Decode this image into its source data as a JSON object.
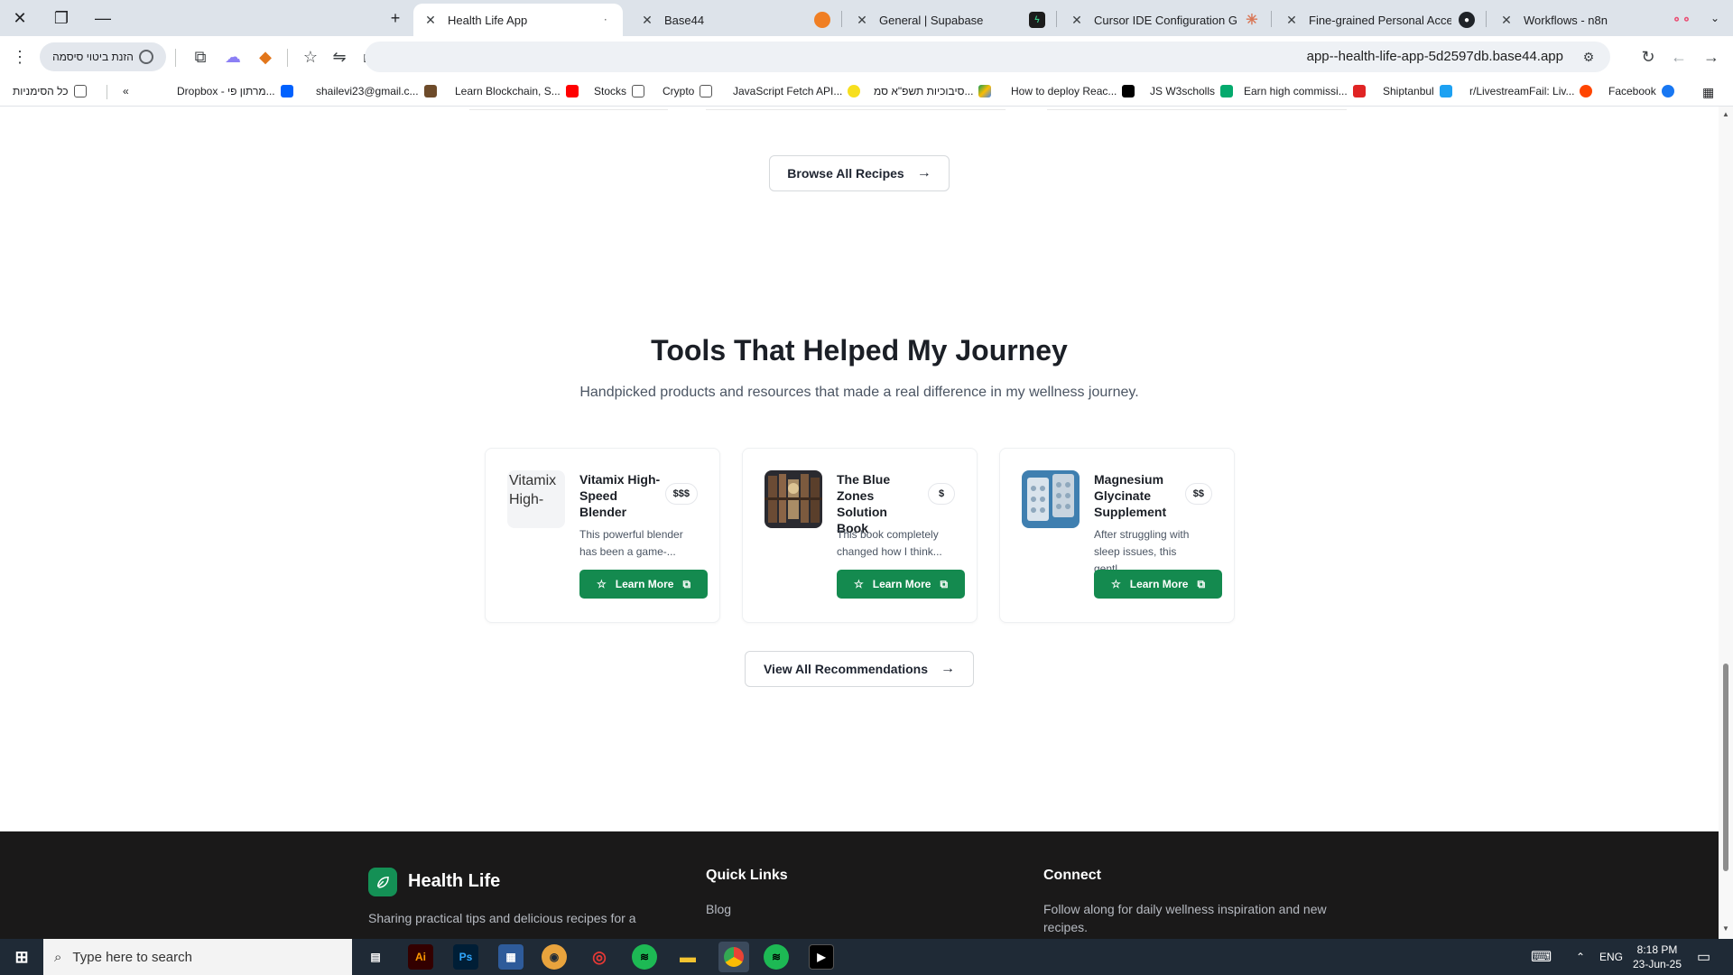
{
  "browser": {
    "tabs": [
      {
        "title": "Health Life App",
        "active": true
      },
      {
        "title": "Base44",
        "active": false
      },
      {
        "title": "General | Supabase",
        "active": false
      },
      {
        "title": "Cursor IDE Configuration Guide",
        "active": false
      },
      {
        "title": "Fine-grained Personal Access To",
        "active": false
      },
      {
        "title": "Workflows - n8n",
        "active": false
      }
    ],
    "url": "app--health-life-app-5d2597db.base44.app",
    "password_chip": "הזנת ביטוי סיסמה",
    "bookmarks": [
      "Facebook",
      "r/LivestreamFail: Liv...",
      "Shiptanbul",
      "Earn high commissi...",
      "JS W3scholls",
      "How to deploy Reac...",
      "סיבוכיות תשפ\"א סמ...",
      "JavaScript Fetch API...",
      "Crypto",
      "Stocks",
      "Learn Blockchain, S...",
      "shailevi23@gmail.c...",
      "Dropbox - מרתון פי...",
      "כל הסימניות"
    ]
  },
  "page": {
    "browse_button": "Browse All Recipes",
    "tools": {
      "title": "Tools That Helped My Journey",
      "subtitle": "Handpicked products and resources that made a real difference in my wellness journey.",
      "learn_label": "Learn More",
      "products": [
        {
          "name": "Vitamix High-Speed Blender",
          "price": "$$$",
          "desc_1": "This powerful blender",
          "desc_2": "has been a game-...",
          "alt": "Vitamix High-"
        },
        {
          "name": "The Blue Zones Solution Book",
          "price": "$",
          "desc_1": "This book completely",
          "desc_2": "changed how I think..."
        },
        {
          "name": "Magnesium Glycinate Supplement",
          "price": "$$",
          "desc_1": "After struggling with",
          "desc_2": "sleep issues, this gentl..."
        }
      ],
      "view_all": "View All Recommendations"
    },
    "footer": {
      "brand": "Health Life",
      "tagline": "Sharing practical tips and delicious recipes for a",
      "quick_links_title": "Quick Links",
      "quick_links_first": "Blog",
      "connect_title": "Connect",
      "connect_text_1": "Follow along for daily wellness inspiration and new",
      "connect_text_2": "recipes."
    }
  },
  "taskbar": {
    "search_placeholder": "Type here to search",
    "language": "ENG",
    "time": "8:18 PM",
    "date": "23-Jun-25"
  },
  "colors": {
    "accent_green": "#148a4f",
    "footer_bg": "#1a1919"
  }
}
